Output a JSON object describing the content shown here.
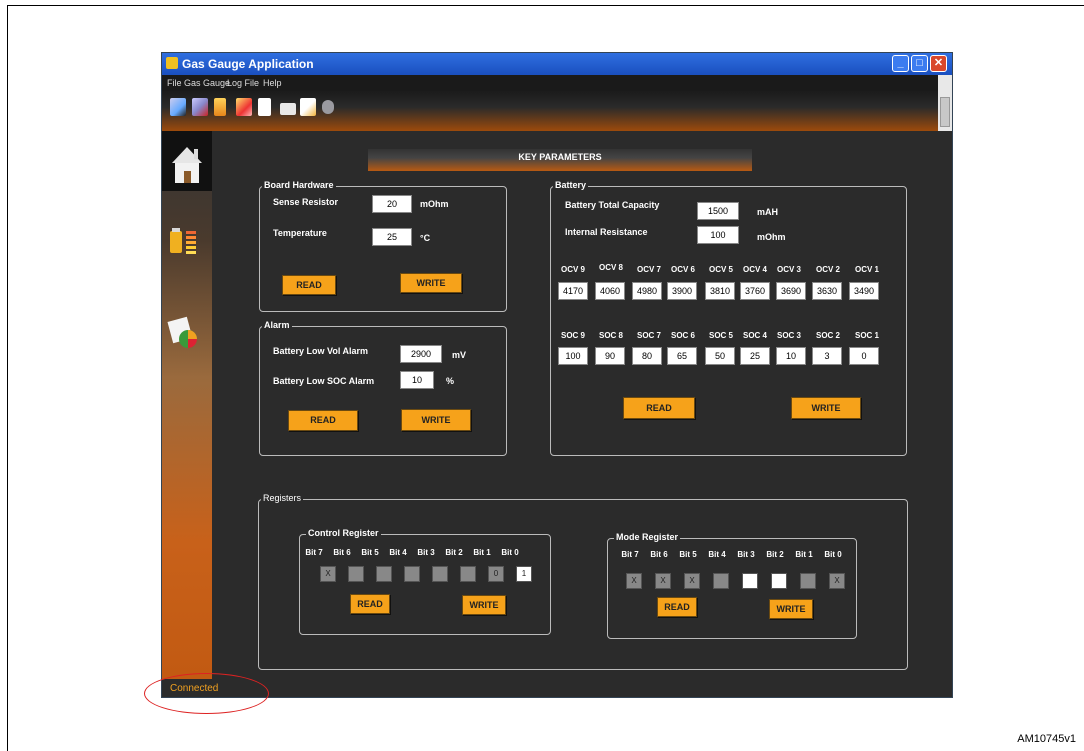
{
  "caption": "AM10745v1",
  "window": {
    "title": "Gas Gauge Application",
    "menu": [
      "File",
      "Gas Gauge",
      "Log File",
      "Help"
    ],
    "status": "Connected"
  },
  "key_parameters": {
    "title": "KEY PARAMETERS"
  },
  "board_hardware": {
    "legend": "Board Hardware",
    "sense_resistor_label": "Sense Resistor",
    "sense_resistor_value": "20",
    "sense_resistor_unit": "mOhm",
    "temperature_label": "Temperature",
    "temperature_value": "25",
    "temperature_unit": "°C",
    "read": "READ",
    "write": "WRITE"
  },
  "alarm": {
    "legend": "Alarm",
    "low_vol_label": "Battery Low Vol Alarm",
    "low_vol_value": "2900",
    "low_vol_unit": "mV",
    "low_soc_label": "Battery Low SOC Alarm",
    "low_soc_value": "10",
    "low_soc_unit": "%",
    "read": "READ",
    "write": "WRITE"
  },
  "battery": {
    "legend": "Battery",
    "capacity_label": "Battery Total Capacity",
    "capacity_value": "1500",
    "capacity_unit": "mAH",
    "resistance_label": "Internal Resistance",
    "resistance_value": "100",
    "resistance_unit": "mOhm",
    "ocv_headers": [
      "OCV 9",
      "OCV 8",
      "OCV 7",
      "OCV 6",
      "OCV 5",
      "OCV 4",
      "OCV 3",
      "OCV 2",
      "OCV 1"
    ],
    "ocv_values": [
      "4170",
      "4060",
      "4980",
      "3900",
      "3810",
      "3760",
      "3690",
      "3630",
      "3490"
    ],
    "soc_headers": [
      "SOC 9",
      "SOC 8",
      "SOC 7",
      "SOC 6",
      "SOC 5",
      "SOC 4",
      "SOC 3",
      "SOC 2",
      "SOC 1"
    ],
    "soc_values": [
      "100",
      "90",
      "80",
      "65",
      "50",
      "25",
      "10",
      "3",
      "0"
    ],
    "read": "READ",
    "write": "WRITE"
  },
  "registers": {
    "legend": "Registers",
    "bit_headers": [
      "Bit 7",
      "Bit 6",
      "Bit 5",
      "Bit 4",
      "Bit 3",
      "Bit 2",
      "Bit 1",
      "Bit 0"
    ],
    "control": {
      "legend": "Control Register",
      "bits": [
        {
          "v": "X",
          "s": "gray"
        },
        {
          "v": "",
          "s": "gray"
        },
        {
          "v": "",
          "s": "gray"
        },
        {
          "v": "",
          "s": "gray"
        },
        {
          "v": "",
          "s": "gray"
        },
        {
          "v": "",
          "s": "gray"
        },
        {
          "v": "0",
          "s": "gray"
        },
        {
          "v": "1",
          "s": "white"
        }
      ],
      "read": "READ",
      "write": "WRITE"
    },
    "mode": {
      "legend": "Mode Register",
      "bits": [
        {
          "v": "X",
          "s": "gray"
        },
        {
          "v": "X",
          "s": "gray"
        },
        {
          "v": "X",
          "s": "gray"
        },
        {
          "v": "",
          "s": "gray"
        },
        {
          "v": "",
          "s": "white"
        },
        {
          "v": "",
          "s": "white"
        },
        {
          "v": "",
          "s": "gray"
        },
        {
          "v": "X",
          "s": "gray"
        }
      ],
      "read": "READ",
      "write": "WRITE"
    }
  },
  "icons": [
    "app-icon",
    "connect-icon",
    "disconnect-icon",
    "battery-icon",
    "close-doc-icon",
    "document-icon",
    "print-icon",
    "chart-icon",
    "package-icon",
    "home-icon",
    "battery-level-icon",
    "calendar-chart-icon"
  ]
}
